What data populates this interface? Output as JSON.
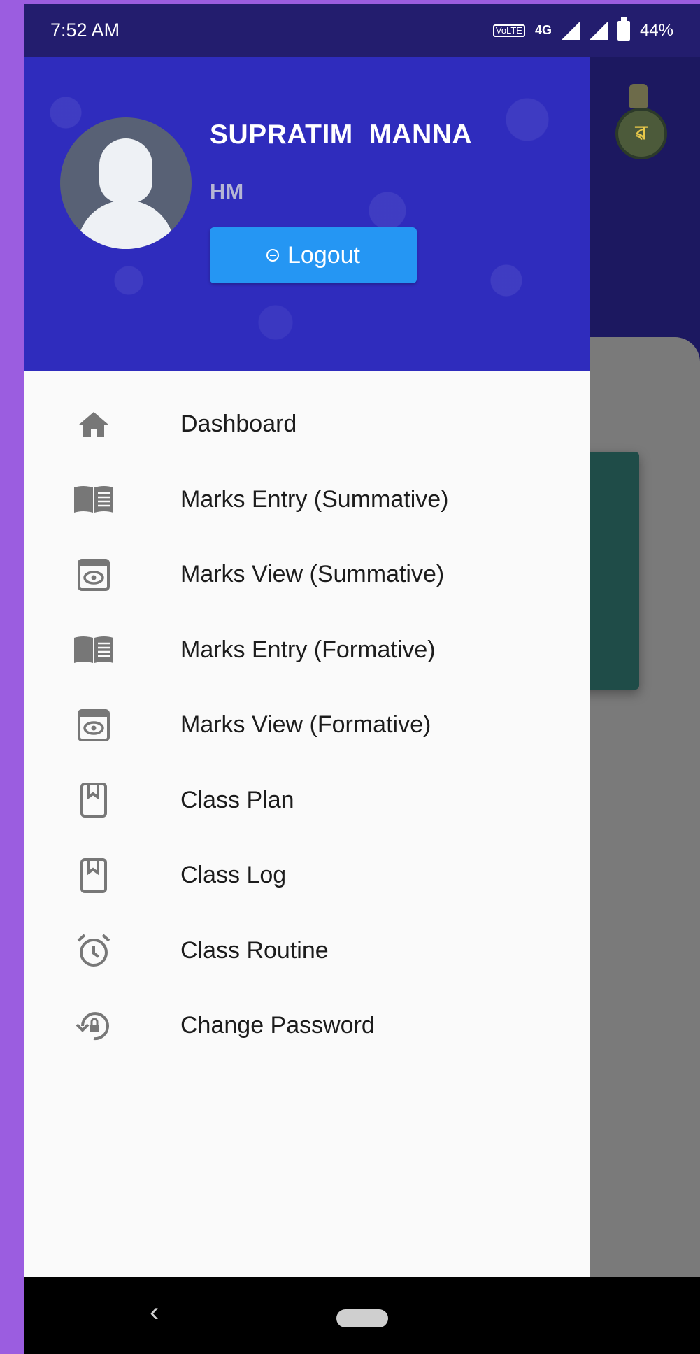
{
  "status_bar": {
    "time": "7:52 AM",
    "network": "4G",
    "volte": "VoLTE",
    "battery": "44%"
  },
  "drawer": {
    "user_name": "SUPRATIM  MANNA",
    "user_role": "HM",
    "logout_label": "Logout",
    "items": [
      {
        "label": "Dashboard",
        "icon": "home-icon"
      },
      {
        "label": "Marks Entry (Summative)",
        "icon": "book-icon"
      },
      {
        "label": "Marks View (Summative)",
        "icon": "eye-icon"
      },
      {
        "label": "Marks Entry (Formative)",
        "icon": "book-icon"
      },
      {
        "label": "Marks View (Formative)",
        "icon": "eye-icon"
      },
      {
        "label": "Class Plan",
        "icon": "bookmark-icon"
      },
      {
        "label": "Class Log",
        "icon": "bookmark-icon"
      },
      {
        "label": "Class Routine",
        "icon": "alarm-clock-icon"
      },
      {
        "label": "Change Password",
        "icon": "lock-reset-icon"
      }
    ]
  },
  "colors": {
    "drawer_header": "#2f2cbd",
    "logout_button": "#2596f3",
    "icon_gray": "#777777",
    "background": "#9b5de0"
  }
}
